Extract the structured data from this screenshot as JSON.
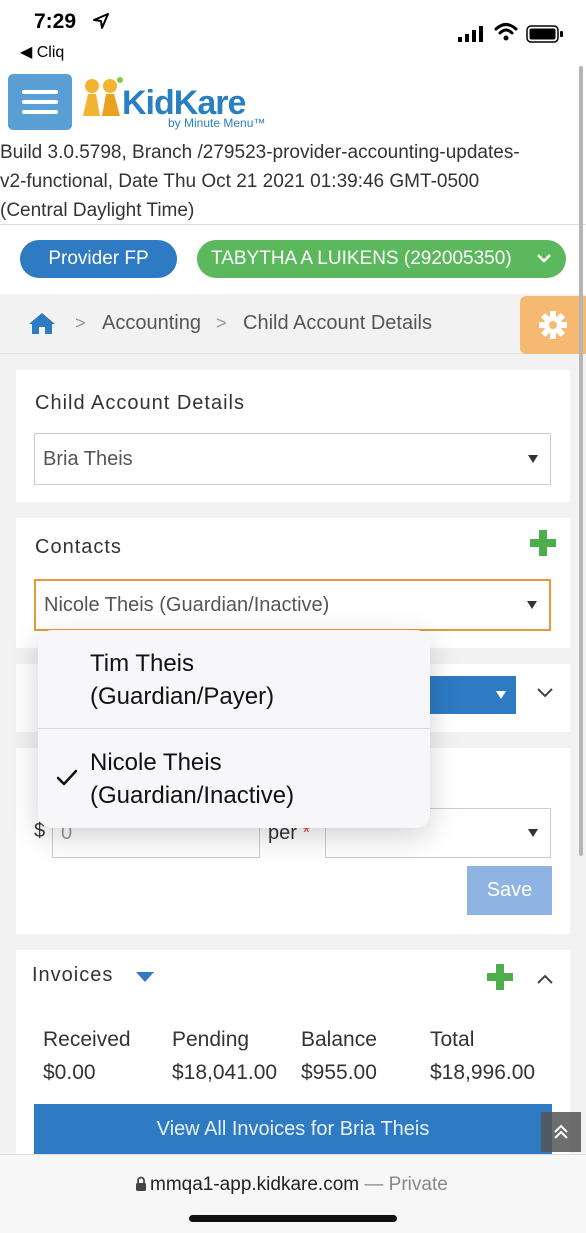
{
  "status_bar": {
    "time": "7:29",
    "back_app": "◀ Cliq"
  },
  "header": {
    "logo_text": "KidKare",
    "logo_sub": "by Minute Menu™"
  },
  "build_info": "Build 3.0.5798, Branch /279523-provider-accounting-updates-\nv2-functional, Date Thu Oct 21 2021 01:39:46 GMT-0500\n(Central Daylight Time)",
  "role_button": "Provider FP",
  "user_button": "TABYTHA A LUIKENS (292005350)",
  "breadcrumb": {
    "items": [
      "Accounting",
      "Child Account Details"
    ],
    "separator": ">"
  },
  "child_panel": {
    "title": "Child Account Details",
    "selected_child": "Bria Theis"
  },
  "contacts_panel": {
    "title": "Contacts",
    "selected_contact": "Nicole Theis (Guardian/Inactive)"
  },
  "dropdown": {
    "options": [
      {
        "label": "Tim Theis\n(Guardian/Payer)",
        "checked": false
      },
      {
        "label": "Nicole Theis\n(Guardian/Inactive)",
        "checked": true
      }
    ]
  },
  "rate_form": {
    "currency": "$",
    "amount_value": "0",
    "per_label": "per",
    "required_mark": "*",
    "save_label": "Save"
  },
  "invoices": {
    "title": "Invoices",
    "summary": [
      {
        "label": "Received",
        "value": "$0.00"
      },
      {
        "label": "Pending",
        "value": "$18,041.00"
      },
      {
        "label": "Balance",
        "value": "$955.00"
      },
      {
        "label": "Total",
        "value": "$18,996.00"
      }
    ],
    "view_all_label": "View All Invoices for Bria Theis"
  },
  "browser": {
    "url": "mmqa1-app.kidkare.com",
    "mode": " — Private"
  },
  "colors": {
    "primary_blue": "#2e7bc4",
    "green": "#5cb85c",
    "orange": "#f5b971"
  }
}
